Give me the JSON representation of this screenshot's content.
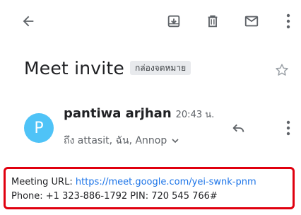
{
  "toolbar": {
    "back_icon": "arrow-back-icon",
    "archive_icon": "archive-icon",
    "delete_icon": "trash-icon",
    "mark_unread_icon": "mail-icon",
    "more_icon": "more-vert-icon"
  },
  "message": {
    "subject": "Meet invite",
    "label": "กล่องจดหมาย",
    "star_icon": "star-outline-icon",
    "sender": {
      "avatar_letter": "P",
      "avatar_color": "#4fc3f7",
      "name": "pantiwa arjhan",
      "time": "20:43 น.",
      "recipients": "ถึง attasit, ฉัน, Annop"
    },
    "reply_icon": "reply-icon",
    "sender_more_icon": "more-vert-icon",
    "body": {
      "meeting_url_label": "Meeting URL: ",
      "meeting_url": "https://meet.google.com/yei-swnk-pnm",
      "phone_line": "Phone: +1 323-886-1792 PIN: 720 545 766#"
    }
  },
  "colors": {
    "highlight_border": "#e0000f",
    "link": "#1a73e8"
  }
}
